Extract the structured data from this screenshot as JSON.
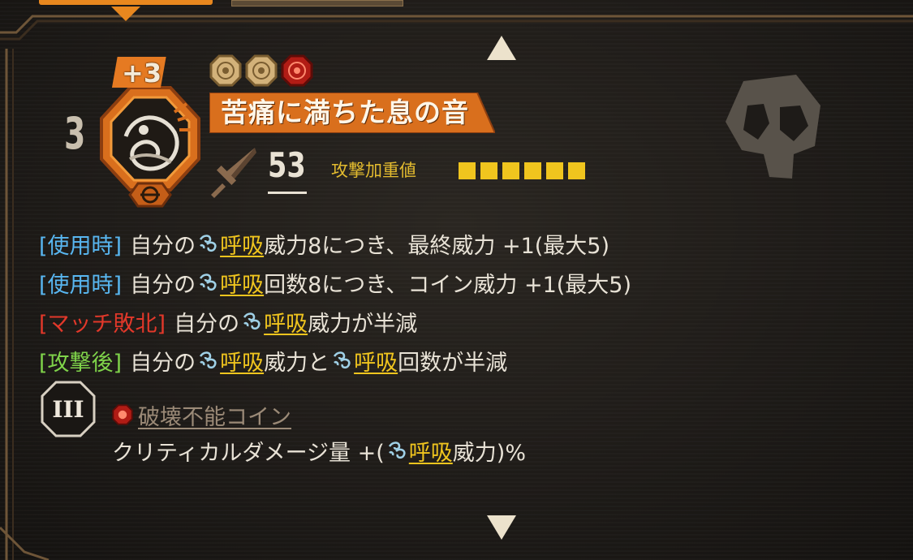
{
  "skill": {
    "level": "3",
    "upgrade": "+3",
    "name": "苦痛に満ちた息の音",
    "power": "53",
    "weight_label": "攻撃加重値",
    "weight_value": 6,
    "coins": [
      {
        "type": "normal"
      },
      {
        "type": "normal"
      },
      {
        "type": "unbreakable"
      }
    ]
  },
  "effects": [
    {
      "tag": "[使用時]",
      "tag_color": "#58b6f0",
      "parts": [
        "自分の",
        "呼吸",
        "威力8につき、最終威力 +1(最大5)"
      ]
    },
    {
      "tag": "[使用時]",
      "tag_color": "#58b6f0",
      "parts": [
        "自分の",
        "呼吸",
        "回数8につき、コイン威力 +1(最大5)"
      ]
    },
    {
      "tag": "[マッチ敗北]",
      "tag_color": "#e2382a",
      "parts": [
        "自分の",
        "呼吸",
        "威力が半減"
      ]
    },
    {
      "tag": "[攻撃後]",
      "tag_color": "#7fd34a",
      "parts": [
        "自分の",
        "呼吸",
        "威力と",
        "呼吸",
        "回数が半減"
      ]
    }
  ],
  "coin_effect": {
    "numeral": "III",
    "title": "破壊不能コイン",
    "text_pre": "クリティカルダメージ量 +(",
    "keyword": "呼吸",
    "text_post": "威力)%"
  },
  "icons": {
    "scroll_up": "triangle-up-icon",
    "scroll_down": "triangle-down-icon",
    "attack_type": "pierce-sword-icon",
    "status": "breath-icon",
    "coin": "coin-icon",
    "unbreakable_coin": "unbreakable-coin-icon",
    "skull": "skull-icon"
  },
  "colors": {
    "accent_orange": "#e8871e",
    "keyword_yellow": "#f0c51e",
    "tag_blue": "#58b6f0",
    "tag_red": "#e2382a",
    "tag_green": "#7fd34a",
    "unbreakable": "#9b8a77"
  }
}
